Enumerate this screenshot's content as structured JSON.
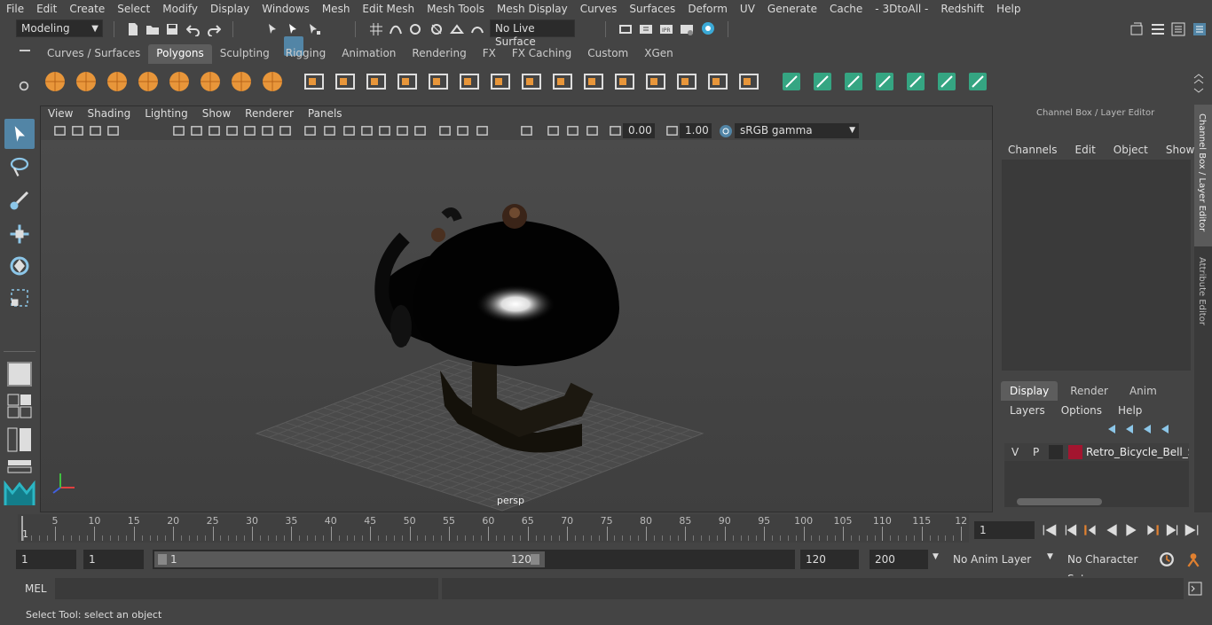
{
  "menubar": [
    "File",
    "Edit",
    "Create",
    "Select",
    "Modify",
    "Display",
    "Windows",
    "Mesh",
    "Edit Mesh",
    "Mesh Tools",
    "Mesh Display",
    "Curves",
    "Surfaces",
    "Deform",
    "UV",
    "Generate",
    "Cache",
    "- 3DtoAll -",
    "Redshift",
    "Help"
  ],
  "status": {
    "mode": "Modeling",
    "live_surface": "No Live Surface"
  },
  "shelf_tabs": [
    {
      "label": "Curves / Surfaces",
      "active": false
    },
    {
      "label": "Polygons",
      "active": true
    },
    {
      "label": "Sculpting",
      "active": false
    },
    {
      "label": "Rigging",
      "active": false
    },
    {
      "label": "Animation",
      "active": false
    },
    {
      "label": "Rendering",
      "active": false
    },
    {
      "label": "FX",
      "active": false
    },
    {
      "label": "FX Caching",
      "active": false
    },
    {
      "label": "Custom",
      "active": false
    },
    {
      "label": "XGen",
      "active": false
    }
  ],
  "shelf_icons": [
    "poly-sphere-icon",
    "poly-cube-icon",
    "poly-cylinder-icon",
    "poly-cone-icon",
    "poly-plane-icon",
    "poly-torus-icon",
    "poly-pyramid-icon",
    "poly-pipe-icon",
    "combine-icon",
    "separate-icon",
    "mirror-icon",
    "smooth-icon",
    "triangulate-icon",
    "quadrangulate-icon",
    "fill-hole-icon",
    "multi-cut-icon",
    "extrude-icon",
    "bridge-icon",
    "bevel-icon",
    "target-weld-icon",
    "merge-icon",
    "append-icon",
    "poly-transfer-icon",
    "planar-map-icon",
    "camera-map-icon",
    "auto-map-icon",
    "uv-editor-icon",
    "unfold-icon",
    "layout-icon",
    "checker-icon",
    "cut-uv-icon"
  ],
  "viewport": {
    "menu": [
      "View",
      "Shading",
      "Lighting",
      "Show",
      "Renderer",
      "Panels"
    ],
    "exposure": "0.00",
    "gamma": "1.00",
    "colorspace": "sRGB gamma",
    "camera_label": "persp"
  },
  "channel_box": {
    "title": "Channel Box / Layer Editor",
    "menu": [
      "Channels",
      "Edit",
      "Object",
      "Show"
    ],
    "tabs": [
      "Display",
      "Render",
      "Anim"
    ],
    "active_tab": "Display",
    "layer_menu": [
      "Layers",
      "Options",
      "Help"
    ],
    "layer": {
      "v": "V",
      "p": "P",
      "name": "Retro_Bicycle_Bell_Stai",
      "color": "#a3152f"
    }
  },
  "side_tabs": [
    "Channel Box / Layer Editor",
    "Attribute Editor"
  ],
  "timeline": {
    "ticks": [
      "5",
      "10",
      "15",
      "20",
      "25",
      "30",
      "35",
      "40",
      "45",
      "50",
      "55",
      "60",
      "65",
      "70",
      "75",
      "80",
      "85",
      "90",
      "95",
      "100",
      "105",
      "110",
      "115",
      "12"
    ],
    "start_marker": "1",
    "current_frame": "1"
  },
  "range": {
    "start": "1",
    "playback_start": "1",
    "slider_start": "1",
    "slider_end": "120",
    "playback_end": "120",
    "end": "200",
    "anim_layer": "No Anim Layer",
    "character_set": "No Character Set"
  },
  "command": {
    "label": "MEL"
  },
  "help_line": "Select Tool: select an object",
  "colors": {
    "accent": "#5285a6",
    "layer_red": "#a3152f",
    "shelf_green": "#35a582"
  }
}
